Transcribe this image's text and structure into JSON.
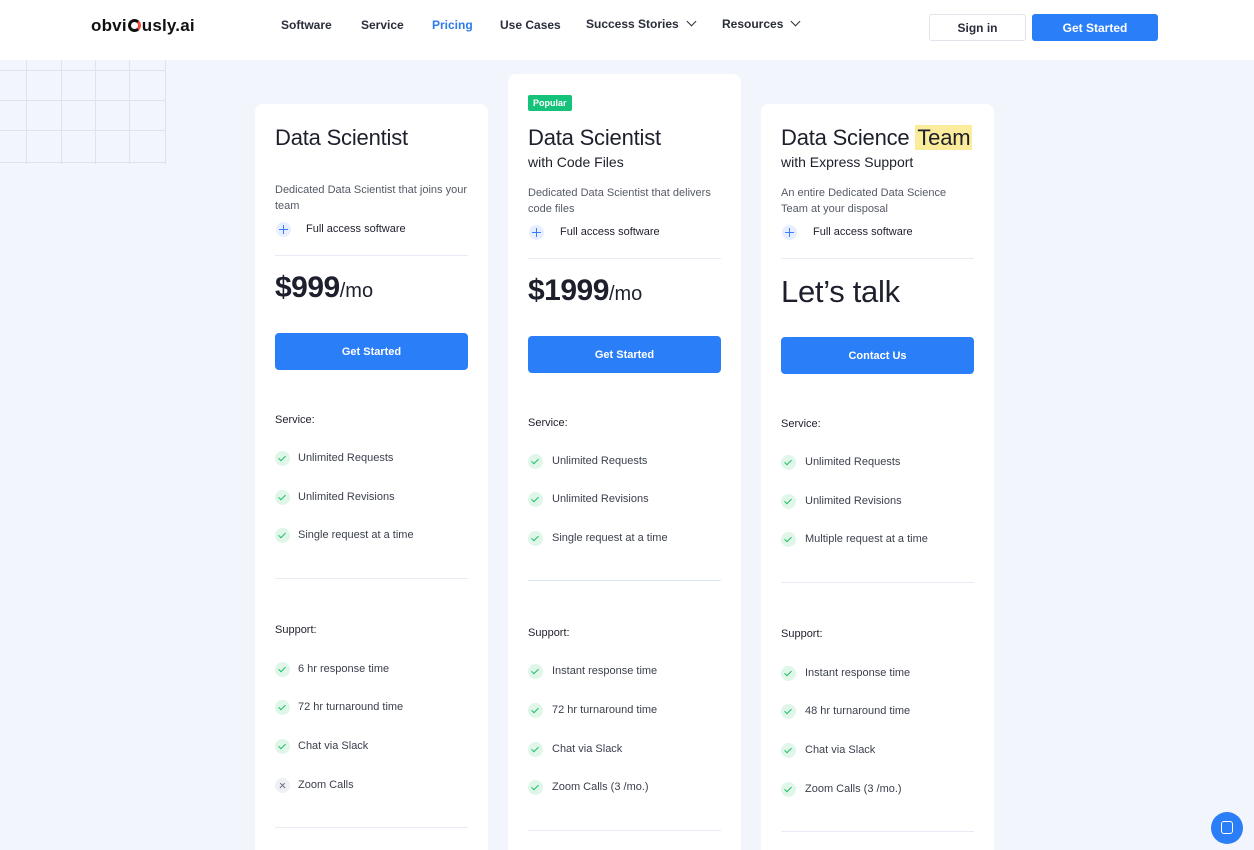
{
  "nav": {
    "logo": "obviously.ai",
    "logo_parts": [
      "obvi",
      "usly.ai"
    ],
    "items": [
      {
        "label": "Software"
      },
      {
        "label": "Service"
      },
      {
        "label": "Pricing",
        "active": true
      },
      {
        "label": "Use Cases"
      },
      {
        "label": "Success Stories",
        "dropdown": true
      },
      {
        "label": "Resources",
        "dropdown": true
      }
    ],
    "signin": "Sign in",
    "get_started": "Get Started"
  },
  "colors": {
    "accent": "#2a7ef7",
    "popular_badge": "#14c27a",
    "check": "#1fbf6b",
    "highlight": "#faec9a",
    "background": "#f2f5fb"
  },
  "plans": [
    {
      "title": "Data Scientist",
      "subtitle": "",
      "description": "Dedicated Data Scientist that joins your team",
      "plus_feature": "Full access software",
      "price": "$999",
      "period": "/mo",
      "cta": "Get Started",
      "service_label": "Service:",
      "service": [
        "Unlimited Requests",
        "Unlimited Revisions",
        "Single request at a time"
      ],
      "support_label": "Support:",
      "support": [
        {
          "text": "6 hr response time",
          "included": true
        },
        {
          "text": "72 hr turnaround time",
          "included": true
        },
        {
          "text": "Chat via Slack",
          "included": true
        },
        {
          "text": "Zoom Calls",
          "included": false
        }
      ]
    },
    {
      "badge": "Popular",
      "title": "Data Scientist",
      "subtitle": "with Code Files",
      "description": "Dedicated Data Scientist that delivers code files",
      "plus_feature": "Full access software",
      "price": "$1999",
      "period": "/mo",
      "cta": "Get Started",
      "service_label": "Service:",
      "service": [
        "Unlimited Requests",
        "Unlimited Revisions",
        "Single request at a time"
      ],
      "support_label": "Support:",
      "support": [
        {
          "text": "Instant response time",
          "included": true
        },
        {
          "text": "72 hr turnaround time",
          "included": true
        },
        {
          "text": "Chat via Slack",
          "included": true
        },
        {
          "text": "Zoom Calls (3 /mo.)",
          "included": true
        }
      ]
    },
    {
      "title": "Data Science",
      "title_highlight": "Team",
      "subtitle": "with Express Support",
      "description": "An entire Dedicated Data Science Team at your disposal",
      "plus_feature": "Full access software",
      "price_text": "Let’s talk",
      "cta": "Contact Us",
      "service_label": "Service:",
      "service": [
        "Unlimited Requests",
        "Unlimited Revisions",
        "Multiple request at a time"
      ],
      "support_label": "Support:",
      "support": [
        {
          "text": "Instant response time",
          "included": true
        },
        {
          "text": "48 hr turnaround time",
          "included": true
        },
        {
          "text": "Chat via Slack",
          "included": true
        },
        {
          "text": "Zoom Calls (3 /mo.)",
          "included": true
        }
      ]
    }
  ]
}
